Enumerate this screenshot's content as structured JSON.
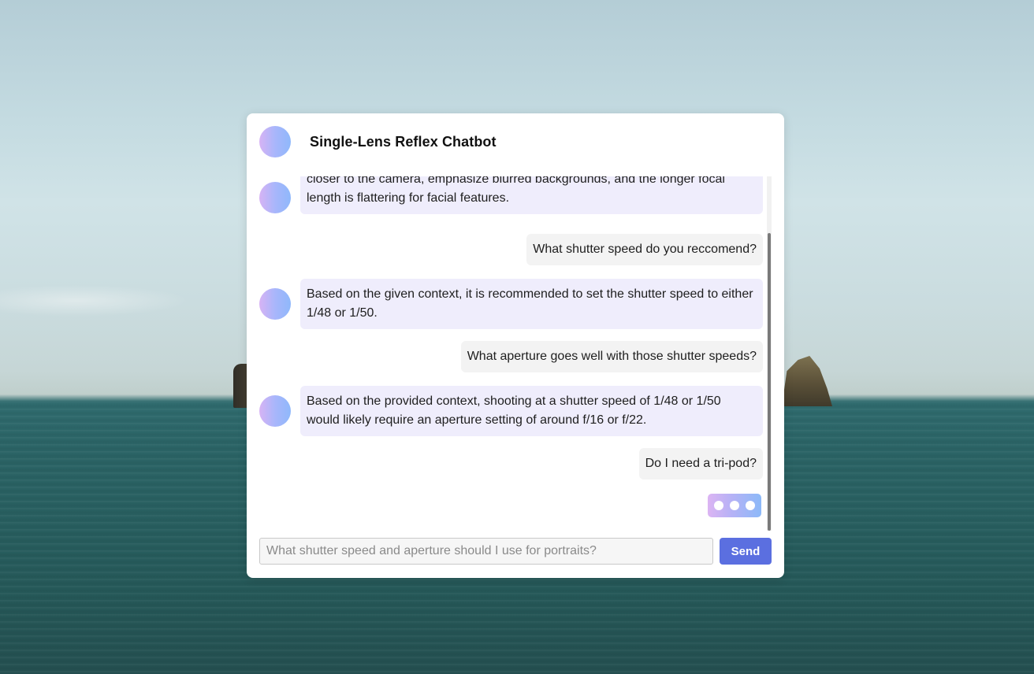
{
  "chat": {
    "title": "Single-Lens Reflex Chatbot",
    "messages": [
      {
        "role": "bot",
        "text": "closer to the camera, emphasize blurred backgrounds, and the longer focal length is flattering for facial features."
      },
      {
        "role": "user",
        "text": "What shutter speed do you reccomend?"
      },
      {
        "role": "bot",
        "text": "Based on the given context, it is recommended to set the shutter speed to either 1/48 or 1/50."
      },
      {
        "role": "user",
        "text": "What aperture goes well with those shutter speeds?"
      },
      {
        "role": "bot",
        "text": "Based on the provided context, shooting at a shutter speed of 1/48 or 1/50 would likely require an aperture setting of around f/16 or f/22."
      },
      {
        "role": "user",
        "text": "Do I need a tri-pod?"
      }
    ],
    "typing_indicator": true
  },
  "composer": {
    "placeholder": "What shutter speed and aperture should I use for portraits?",
    "value": "",
    "send_label": "Send"
  },
  "colors": {
    "accent": "#5b6fe0",
    "bot_bubble": "#efedfc",
    "user_bubble": "#f3f3f3",
    "avatar_gradient_start": "#d7b3f4",
    "avatar_gradient_end": "#8fb8fb"
  },
  "icons": {
    "avatar": "gradient-circle-avatar",
    "typing": "three-dots"
  }
}
